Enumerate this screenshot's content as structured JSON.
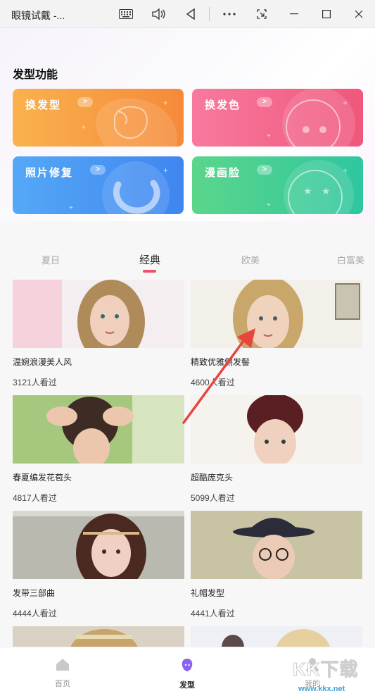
{
  "window": {
    "title": "眼镜试戴 -..."
  },
  "header": {
    "section_title": "发型功能"
  },
  "features": [
    {
      "label": "换发型",
      "arrow": ">"
    },
    {
      "label": "换发色",
      "arrow": ">"
    },
    {
      "label": "照片修复",
      "arrow": ">"
    },
    {
      "label": "漫画脸",
      "arrow": ">"
    }
  ],
  "tabs": [
    {
      "label": "夏日"
    },
    {
      "label": "经典"
    },
    {
      "label": "欧美"
    },
    {
      "label": "白富美"
    }
  ],
  "active_tab": "经典",
  "styles": [
    {
      "name": "温婉浪漫美人风",
      "views": "3121人看过"
    },
    {
      "name": "精致优雅侧发髻",
      "views": "4600人看过"
    },
    {
      "name": "春夏编发花苞头",
      "views": "4817人看过"
    },
    {
      "name": "超酷庞克头",
      "views": "5099人看过"
    },
    {
      "name": "发带三部曲",
      "views": "4444人看过"
    },
    {
      "name": "礼帽发型",
      "views": "4441人看过"
    }
  ],
  "bottom_nav": [
    {
      "label": "首页",
      "icon": "home-icon"
    },
    {
      "label": "发型",
      "icon": "hairstyle-icon"
    },
    {
      "label": "我的",
      "icon": "profile-icon"
    }
  ],
  "watermark": {
    "text": "KK下载",
    "url": "www.kkx.net"
  },
  "colors": {
    "accent": "#f0506e",
    "active_nav": "#8a63f0"
  }
}
